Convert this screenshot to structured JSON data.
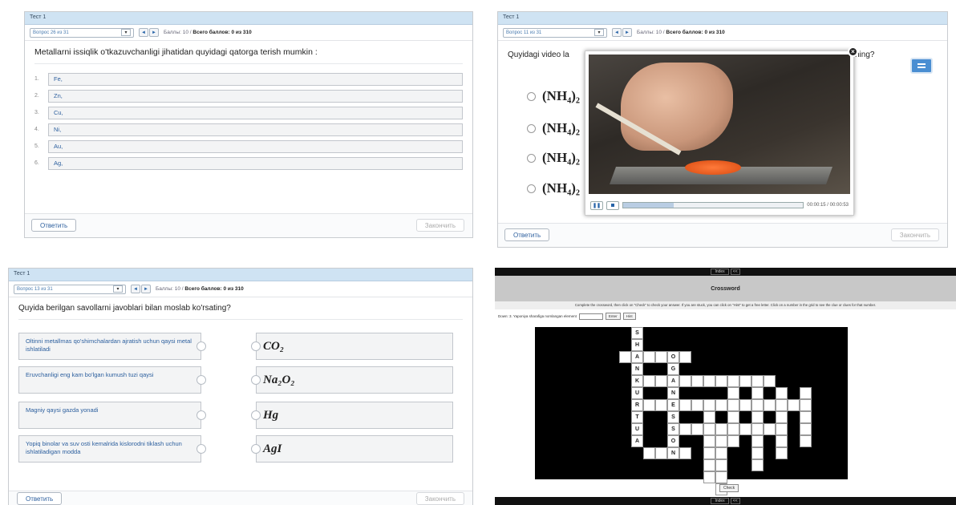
{
  "shared": {
    "select_arrow": "▾",
    "prev_arrow": "◄",
    "next_arrow": "►"
  },
  "panel1": {
    "header": "Тест 1",
    "question_select": "Вопрос 26 из 31",
    "score": "Баллы: 10 / ",
    "total": "Всего баллов: 0 из 310",
    "question": "Metallarni issiqlik o'tkazuvchanligi jihatidan quyidagi qatorga terish mumkin :",
    "options": [
      {
        "n": "1.",
        "v": "Fe,"
      },
      {
        "n": "2.",
        "v": "Zn,"
      },
      {
        "n": "3.",
        "v": "Cu,"
      },
      {
        "n": "4.",
        "v": "Ni,"
      },
      {
        "n": "5.",
        "v": "Au,"
      },
      {
        "n": "6.",
        "v": "Ag,"
      }
    ],
    "answer": "Ответить",
    "finish": "Закончить"
  },
  "panel2": {
    "header": "Тест 1",
    "question_select": "Вопрос 11 из 31",
    "score": "Баллы: 10 / ",
    "total": "Всего баллов: 0 из 310",
    "question_start": "Quyidagi video la",
    "question_end": "ning?",
    "options": [
      "(NH₄)₂",
      "(NH₄)₂",
      "(NH₄)₂",
      "(NH₄)₂"
    ],
    "video_time": "00:00:15 / 00:00:53",
    "video_progress": 0.28,
    "answer": "Ответить",
    "finish": "Закончить"
  },
  "panel3": {
    "header": "Тест 1",
    "question_select": "Вопрос 13 из 31",
    "score": "Баллы: 10 / ",
    "total": "Всего баллов: 0 из 310",
    "question": "Quyida berilgan savollarni javoblari bilan moslab ko'rsating?",
    "left": [
      "Oltinni metallmas qo'shimchalardan ajratish uchun qaysi metal ishlatiladi",
      "Eruvchanligi eng kam bo'lgan kumush tuzi qaysi",
      "Magniy qaysi gazda yonadi",
      "Yopiq binolar va suv osti kemalrida kislorodni tiklash uchun ishlatiladigan modda"
    ],
    "right": [
      "CO₂",
      "Na₂O₂",
      "Hg",
      "AgI"
    ],
    "answer": "Ответить",
    "finish": "Закончить"
  },
  "panel4": {
    "tab_index": "Index",
    "tab_more": "<<",
    "title": "Crossword",
    "instructions": "Complete the crossword, then click on \"Check\" to check your answer. If you are stuck, you can click on \"Hint\" to get a free letter. Click on a number in the grid to see the clue or clues for that number.",
    "clue": "Down: 3. Yaponiya sharafiga nomlangan element",
    "enter": "Enter",
    "hint": "Hint",
    "check": "Check",
    "down_letters": [
      "S",
      "H",
      "A",
      "N",
      "K",
      "U",
      "R",
      "T",
      "U",
      "A"
    ],
    "across_letters": [
      "O",
      "G",
      "A",
      "N",
      "E",
      "S",
      "S",
      "O",
      "N"
    ],
    "numbers": [
      "3",
      "5",
      "1",
      "2",
      "4",
      "6",
      "7",
      "8",
      "9",
      "10",
      "11",
      "12"
    ]
  }
}
